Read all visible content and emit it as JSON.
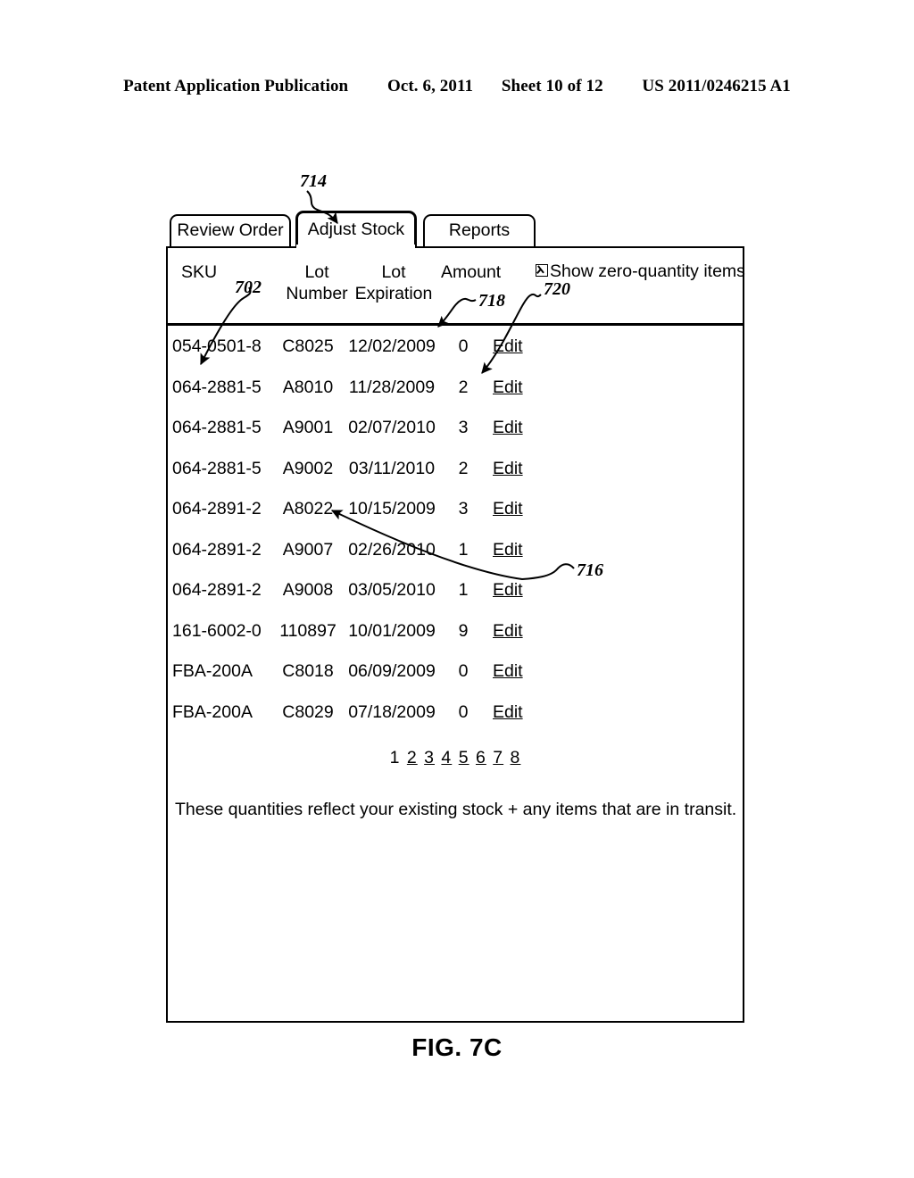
{
  "patent_header": {
    "publication": "Patent Application Publication",
    "date": "Oct. 6, 2011",
    "sheet": "Sheet 10 of 12",
    "number": "US 2011/0246215 A1"
  },
  "figure": {
    "caption": "FIG. 7C"
  },
  "tabs": [
    {
      "label": "Review Order",
      "active": false
    },
    {
      "label": "Adjust Stock",
      "active": true
    },
    {
      "label": "Reports",
      "active": false
    }
  ],
  "table": {
    "headers": {
      "sku": "SKU",
      "lot_number_line1": "Lot",
      "lot_number_line2": "Number",
      "lot_expiration_line1": "Lot",
      "lot_expiration_line2": "Expiration",
      "amount": "Amount"
    },
    "rows": [
      {
        "sku": "054-0501-8",
        "lot_number": "C8025",
        "lot_expiration": "12/02/2009",
        "amount": "0",
        "action": "Edit"
      },
      {
        "sku": "064-2881-5",
        "lot_number": "A8010",
        "lot_expiration": "11/28/2009",
        "amount": "2",
        "action": "Edit"
      },
      {
        "sku": "064-2881-5",
        "lot_number": "A9001",
        "lot_expiration": "02/07/2010",
        "amount": "3",
        "action": "Edit"
      },
      {
        "sku": "064-2881-5",
        "lot_number": "A9002",
        "lot_expiration": "03/11/2010",
        "amount": "2",
        "action": "Edit"
      },
      {
        "sku": "064-2891-2",
        "lot_number": "A8022",
        "lot_expiration": "10/15/2009",
        "amount": "3",
        "action": "Edit"
      },
      {
        "sku": "064-2891-2",
        "lot_number": "A9007",
        "lot_expiration": "02/26/2010",
        "amount": "1",
        "action": "Edit"
      },
      {
        "sku": "064-2891-2",
        "lot_number": "A9008",
        "lot_expiration": "03/05/2010",
        "amount": "1",
        "action": "Edit"
      },
      {
        "sku": "161-6002-0",
        "lot_number": "110897",
        "lot_expiration": "10/01/2009",
        "amount": "9",
        "action": "Edit"
      },
      {
        "sku": "FBA-200A",
        "lot_number": "C8018",
        "lot_expiration": "06/09/2009",
        "amount": "0",
        "action": "Edit"
      },
      {
        "sku": "FBA-200A",
        "lot_number": "C8029",
        "lot_expiration": "07/18/2009",
        "amount": "0",
        "action": "Edit"
      }
    ]
  },
  "zero_quantity_toggle": {
    "label": "Show zero-quantity items",
    "checked": true
  },
  "pagination": {
    "current": "1",
    "pages": [
      "1",
      "2",
      "3",
      "4",
      "5",
      "6",
      "7",
      "8"
    ]
  },
  "note": "These quantities reflect your existing stock + any items that are in transit.",
  "reference_numerals": {
    "n714": "714",
    "n702": "702",
    "n718": "718",
    "n720": "720",
    "n716": "716"
  }
}
